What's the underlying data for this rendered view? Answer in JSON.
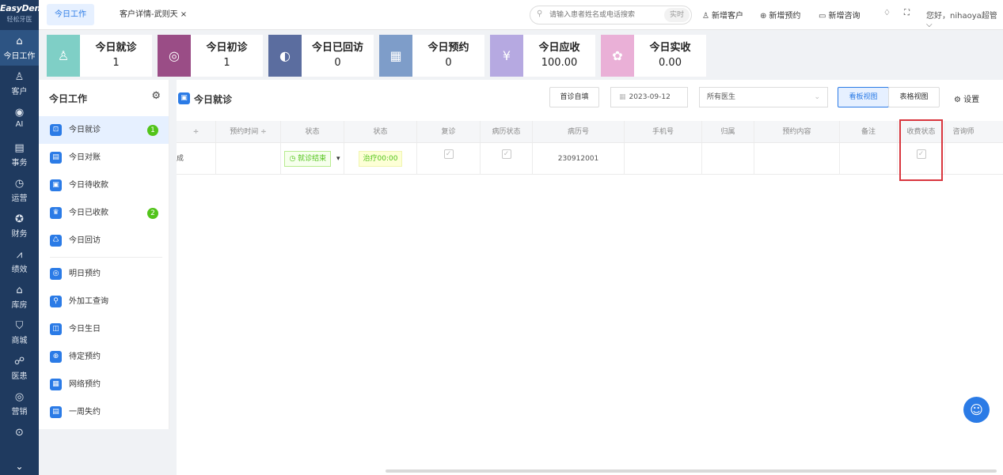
{
  "brand": {
    "name": "EasyDent",
    "subtitle": "轻松牙医"
  },
  "nav": {
    "items": [
      {
        "label": "今日工作",
        "icon": "⌂",
        "active": true
      },
      {
        "label": "客户",
        "icon": "♙"
      },
      {
        "label": "AI",
        "icon": "◉"
      },
      {
        "label": "事务",
        "icon": "▤"
      },
      {
        "label": "运营",
        "icon": "◷"
      },
      {
        "label": "财务",
        "icon": "✪"
      },
      {
        "label": "绩效",
        "icon": "⩘"
      },
      {
        "label": "库房",
        "icon": "⌂"
      },
      {
        "label": "商城",
        "icon": "⛉"
      },
      {
        "label": "医患",
        "icon": "☍"
      },
      {
        "label": "营销",
        "icon": "◎"
      },
      {
        "label": "",
        "icon": "⊙"
      }
    ],
    "more_icon": "⌄"
  },
  "topbar": {
    "tabs": [
      {
        "label": "今日工作",
        "active": true
      },
      {
        "label": "客户详情-武则天 ×",
        "active": false
      }
    ],
    "search_placeholder": "请输入患者姓名或电话搜索",
    "search_realtime": "实时",
    "actions": [
      {
        "label": "新增客户",
        "icon": "♙"
      },
      {
        "label": "新增预约",
        "icon": "⊕"
      },
      {
        "label": "新增咨询",
        "icon": "▭"
      }
    ],
    "bell_icon": "♢",
    "fullscreen_icon": "⛶",
    "greeting": "您好，nihaoya超管 ⌵"
  },
  "stats": [
    {
      "title": "今日就诊",
      "value": "1",
      "color": "#7fcfc6",
      "icon": "♙"
    },
    {
      "title": "今日初诊",
      "value": "1",
      "color": "#9a4d86",
      "icon": "◎"
    },
    {
      "title": "今日已回访",
      "value": "0",
      "color": "#5b6d9f",
      "icon": "◐"
    },
    {
      "title": "今日预约",
      "value": "0",
      "color": "#7e9dc9",
      "icon": "▦"
    },
    {
      "title": "今日应收",
      "value": "100.00",
      "color": "#b6a9e1",
      "icon": "¥"
    },
    {
      "title": "今日实收",
      "value": "0.00",
      "color": "#eab0d7",
      "icon": "✿"
    }
  ],
  "sidebar": {
    "title": "今日工作",
    "items": [
      {
        "label": "今日就诊",
        "icon": "⊡",
        "badge": "1",
        "active": true
      },
      {
        "label": "今日对账",
        "icon": "▤"
      },
      {
        "label": "今日待收款",
        "icon": "▣"
      },
      {
        "label": "今日已收款",
        "icon": "♛",
        "badge": "2"
      },
      {
        "label": "今日回访",
        "icon": "♺"
      },
      {
        "label": "明日预约",
        "icon": "◎",
        "divider_before": true
      },
      {
        "label": "外加工查询",
        "icon": "⚲"
      },
      {
        "label": "今日生日",
        "icon": "◫"
      },
      {
        "label": "待定预约",
        "icon": "⊕"
      },
      {
        "label": "网络预约",
        "icon": "▦"
      },
      {
        "label": "一周失约",
        "icon": "▤"
      }
    ]
  },
  "main": {
    "title": "今日就诊",
    "first_visit_btn": "首诊自填",
    "date": "2023-09-12",
    "date_icon": "▦",
    "doctor_select": "所有医生",
    "board_view": "看板视图",
    "table_view": "表格视图",
    "settings": "⚙ 设置"
  },
  "table": {
    "headers": [
      "÷",
      "预约时间 ÷",
      "状态",
      "状态",
      "复诊",
      "病历状态",
      "病历号",
      "手机号",
      "归属",
      "预约内容",
      "备注",
      "收费状态",
      "咨询师"
    ],
    "rows": [
      {
        "c0": "成",
        "c1": "",
        "status_tag": "◷ 就诊结束",
        "status_caret": "▾",
        "treat_tag": "治疗00:00",
        "revisit": "✓",
        "record_status": "✓",
        "record_no": "230912001",
        "phone": "",
        "owner": "",
        "content": "",
        "note": "",
        "charge": "✓",
        "consultant": ""
      }
    ]
  },
  "float_icon": "☺"
}
